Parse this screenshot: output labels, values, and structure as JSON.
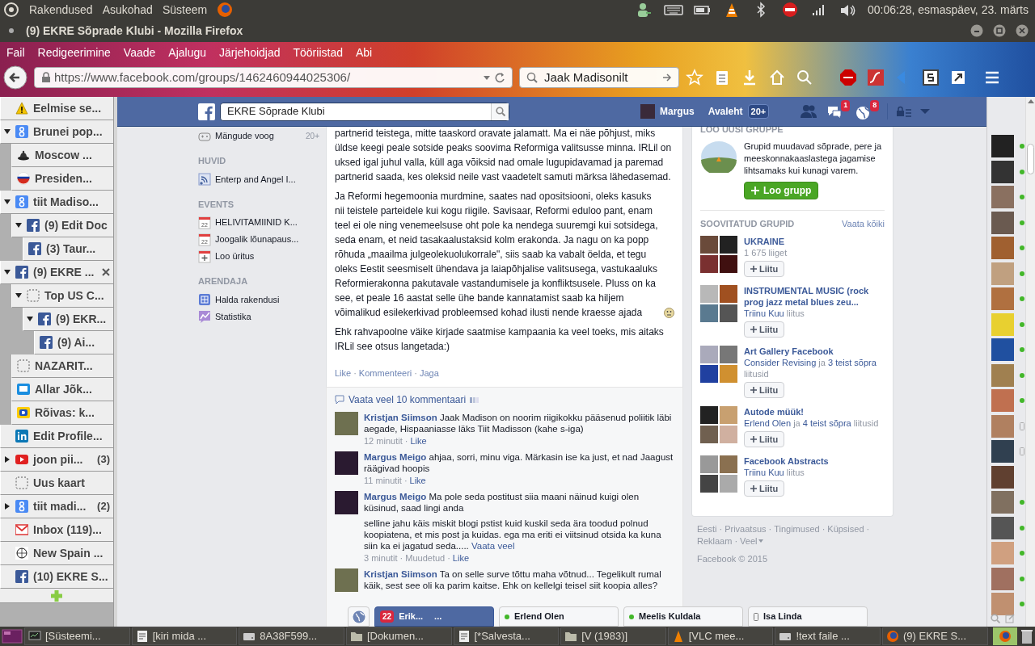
{
  "top_panel": {
    "menus": [
      "Rakendused",
      "Asukohad",
      "Süsteem"
    ],
    "clock": "00:06:28, esmaspäev, 23. märts"
  },
  "window": {
    "title": "(9) EKRE Sõprade Klubi - Mozilla Firefox"
  },
  "menu": [
    "Fail",
    "Redigeerimine",
    "Vaade",
    "Ajalugu",
    "Järjehoidjad",
    "Tööriistad",
    "Abi"
  ],
  "nav": {
    "url": "https://www.facebook.com/groups/1462460944025306/",
    "search_value": "Jaak Madisonilt"
  },
  "tab_tree": [
    {
      "title": "Eelmise se...",
      "kind": "warning"
    },
    {
      "title": "Brunei pop...",
      "kind": "google",
      "expanded": true,
      "children": [
        {
          "title": "Moscow ...",
          "kind": "hat"
        },
        {
          "title": "Presiden...",
          "kind": "flag"
        }
      ]
    },
    {
      "title": "tiit Madiso...",
      "kind": "google",
      "expanded": true,
      "children": [
        {
          "title": "(9) Edit Doc",
          "kind": "facebook",
          "expanded": true,
          "children": [
            {
              "title": "(3) Taur...",
              "kind": "facebook"
            }
          ]
        }
      ]
    },
    {
      "title": "(9) EKRE ...",
      "kind": "facebook",
      "expanded": true,
      "closable": true,
      "children": [
        {
          "title": "Top US C...",
          "kind": "blank",
          "expanded": true,
          "children": [
            {
              "title": "(9) EKR...",
              "kind": "facebook",
              "expanded": true,
              "children": [
                {
                  "title": "(9) Ai...",
                  "kind": "facebook"
                }
              ]
            }
          ]
        },
        {
          "title": "NAZARIT...",
          "kind": "blank"
        },
        {
          "title": "Allar Jõk...",
          "kind": "pm"
        },
        {
          "title": "Rõivas: k...",
          "kind": "delfi"
        }
      ]
    },
    {
      "title": "Edit Profile...",
      "kind": "linkedin"
    },
    {
      "title": "joon pii...",
      "kind": "youtube",
      "expanded": false,
      "count": "(3)"
    },
    {
      "title": "Uus kaart",
      "kind": "blank"
    },
    {
      "title": "tiit madi...",
      "kind": "google",
      "expanded": false,
      "count": "(2)"
    },
    {
      "title": "Inbox (119)...",
      "kind": "gmail"
    },
    {
      "title": "New Spain ...",
      "kind": "wiki"
    },
    {
      "title": "(10) EKRE S...",
      "kind": "facebook"
    }
  ],
  "facebook": {
    "header": {
      "search_value": "EKRE Sõprade Klubi",
      "user": "Margus",
      "home": "Avaleht",
      "home_count": "20+",
      "messages_badge": "1",
      "notifications_badge": "8"
    },
    "left_nav": [
      {
        "items": [
          {
            "label": "Mängude voog",
            "kind": "games",
            "count": "20+"
          }
        ]
      },
      {
        "heading": "HUVID",
        "items": [
          {
            "label": "Enterp and Angel I...",
            "kind": "feed"
          }
        ]
      },
      {
        "heading": "EVENTS",
        "items": [
          {
            "label": "HELIVITAMIINID K...",
            "kind": "calendar",
            "date": "22"
          },
          {
            "label": "Joogalik lõunapaus...",
            "kind": "calendar",
            "date": "22"
          },
          {
            "label": "Loo üritus",
            "kind": "add-event"
          }
        ]
      },
      {
        "heading": "ARENDAJA",
        "items": [
          {
            "label": "Halda rakendusi",
            "kind": "apps"
          },
          {
            "label": "Statistika",
            "kind": "stats"
          }
        ]
      }
    ],
    "separator": "·",
    "post": {
      "paragraphs": [
        {
          "text": "partnerid teistega, mitte taaskord oravate jalamatt. Ma ei näe põhjust, miks üldse keegi peale sotside peaks soovima Reformiga valitsusse minna. IRLil on uksed igal juhul valla, küll aga võiksid nad omale lugupidavamad ja paremad partnerid saada, kes oleksid neile vast vaadetelt samuti märksa lähedasemad.",
          "emoticon": false
        },
        {
          "text": "Ja Reformi hegemoonia murdmine, saates nad opositsiooni, oleks kasuks nii teistele parteidele kui kogu riigile. Savisaar, Reformi eduloo pant, enam teel ei ole ning venemeelsuse oht pole ka nendega suuremgi kui sotsidega, seda enam, et neid tasakaalustaksid kolm erakonda. Ja nagu on ka popp rõhuda „maailma julgeolekuolukorrale\", siis saab ka vabalt öelda, et tegu oleks Eestit seesmiselt ühendava ja laiapõhjalise valitsusega, vastukaaluks Reformierakonna pakutavale vastandumisele ja konfliktsusele. Pluss on ka see, et peale 16 aastat selle ühe bande kannatamist saab ka hiljem võimalikud esilekerkivad probleemsed kohad ilusti nende kraesse ajada",
          "emoticon": true
        },
        {
          "text": "Ehk rahvapoolne väike kirjade saatmise kampaania ka veel toeks, mis aitaks IRLil see otsus langetada:)",
          "emoticon": false
        }
      ],
      "actions": [
        "Like",
        "Kommenteeri",
        "Jaga"
      ],
      "view_more": "Vaata veel 10 kommentaari",
      "comments": [
        {
          "author": "Kristjan Siimson",
          "paragraphs": [
            "Jaak Madison on noorim riigikokku pääsenud poliitik läbi aegade, Hispaaniasse läks Tiit Madisson (kahe s-iga)"
          ],
          "meta": [
            {
              "text": "12 minutit",
              "kind": "plain"
            },
            {
              "text": "Like",
              "kind": "link"
            }
          ]
        },
        {
          "author": "Margus Meigo",
          "paragraphs": [
            "ahjaa, sorri, minu viga. Märkasin ise ka just, et nad Jaagust räägivad hoopis"
          ],
          "meta": [
            {
              "text": "11 minutit",
              "kind": "plain"
            },
            {
              "text": "Like",
              "kind": "link"
            }
          ]
        },
        {
          "author": "Margus Meigo",
          "paragraphs": [
            "Ma pole seda postitust siia maani näinud kuigi olen küsinud, saad lingi anda",
            "selline jahu käis miskit blogi pstist kuid kuskil seda ära toodud polnud koopiatena, et mis post ja kuidas. ega ma eriti ei viitsinud otsida ka kuna siin ka ei jagatud seda....."
          ],
          "more": "Vaata veel",
          "meta": [
            {
              "text": "3 minutit",
              "kind": "plain"
            },
            {
              "text": "Muudetud",
              "kind": "plain"
            },
            {
              "text": "Like",
              "kind": "link"
            }
          ]
        },
        {
          "author": "Kristjan Siimson",
          "paragraphs": [
            "Ta on selle surve tõttu maha võtnud... Tegelikult rumal käik, sest see oli ka parim kaitse. Ehk on kellelgi teisel siit koopia alles?"
          ]
        }
      ]
    },
    "create_group": {
      "heading": "LOO UUSI GRUPPE",
      "text": "Grupid muudavad sõprade, pere ja meeskonnakaaslastega jagamise lihtsamaks kui kunagi varem.",
      "button": "Loo grupp"
    },
    "suggested": {
      "heading": "SOOVITATUD GRUPID",
      "see_all": "Vaata kõiki",
      "groups": [
        {
          "name": "UKRAINE",
          "subtitle": [
            {
              "text": "1 675 liiget",
              "kind": "plain"
            }
          ],
          "button": "Liitu"
        },
        {
          "name": "INSTRUMENTAL MUSIC (rock prog jazz metal blues zeu...",
          "subtitle": [
            {
              "text": "Triinu Kuu",
              "kind": "link"
            },
            {
              "text": "liitus",
              "kind": "plain"
            }
          ],
          "button": "Liitu"
        },
        {
          "name": "Art Gallery Facebook",
          "subtitle": [
            {
              "text": "Consider Revising",
              "kind": "link"
            },
            {
              "text": "ja",
              "kind": "plain"
            },
            {
              "text": "3 teist sõpra",
              "kind": "link"
            },
            {
              "text": "liitusid",
              "kind": "plain"
            }
          ],
          "button": "Liitu"
        },
        {
          "name": "Autode müük!",
          "subtitle": [
            {
              "text": "Erlend Olen",
              "kind": "link"
            },
            {
              "text": "ja",
              "kind": "plain"
            },
            {
              "text": "4 teist sõpra",
              "kind": "link"
            },
            {
              "text": "liitusid",
              "kind": "plain"
            }
          ],
          "button": "Liitu"
        },
        {
          "name": "Facebook Abstracts",
          "subtitle": [
            {
              "text": "Triinu Kuu",
              "kind": "link"
            },
            {
              "text": "liitus",
              "kind": "plain"
            }
          ],
          "button": "Liitu"
        }
      ]
    },
    "footer": {
      "links": [
        "Eesti",
        "Privaatsus",
        "Tingimused",
        "Küpsised",
        "Reklaam",
        "Veel"
      ],
      "copyright": "Facebook © 2015"
    },
    "chat_contacts": [
      {
        "kind": "online"
      },
      {
        "kind": "online"
      },
      {
        "kind": "online"
      },
      {
        "kind": "online"
      },
      {
        "kind": "online"
      },
      {
        "kind": "online"
      },
      {
        "kind": "online"
      },
      {
        "kind": "online"
      },
      {
        "kind": "online"
      },
      {
        "kind": "online"
      },
      {
        "kind": "online"
      },
      {
        "kind": "mobile"
      },
      {
        "kind": "mobile"
      },
      {
        "kind": "offline"
      },
      {
        "kind": "online"
      },
      {
        "kind": "online"
      },
      {
        "kind": "online"
      },
      {
        "kind": "online"
      },
      {
        "kind": "online"
      }
    ],
    "chat_tabs": [
      {
        "kind": "globe",
        "selected": false
      },
      {
        "kind": "unread",
        "selected": true,
        "badge": "22",
        "label": "Erik...",
        "more": "..."
      },
      {
        "kind": "online",
        "selected": false,
        "label": "Erlend Olen"
      },
      {
        "kind": "online",
        "selected": false,
        "label": "Meelis Kuldala"
      },
      {
        "kind": "mobile",
        "selected": false,
        "label": "Isa Linda"
      }
    ]
  },
  "taskbar": [
    {
      "label": "[Süsteemi...",
      "kind": "monitor"
    },
    {
      "label": "[kiri mida ...",
      "kind": "editor"
    },
    {
      "label": "8A38F599...",
      "kind": "disk"
    },
    {
      "label": "[Dokumen...",
      "kind": "folder"
    },
    {
      "label": "[*Salvesta...",
      "kind": "editor"
    },
    {
      "label": "[V (1983)]",
      "kind": "folder"
    },
    {
      "label": "[VLC mee...",
      "kind": "vlc"
    },
    {
      "label": "!text faile ...",
      "kind": "disk"
    },
    {
      "label": "(9) EKRE S...",
      "kind": "firefox"
    }
  ]
}
